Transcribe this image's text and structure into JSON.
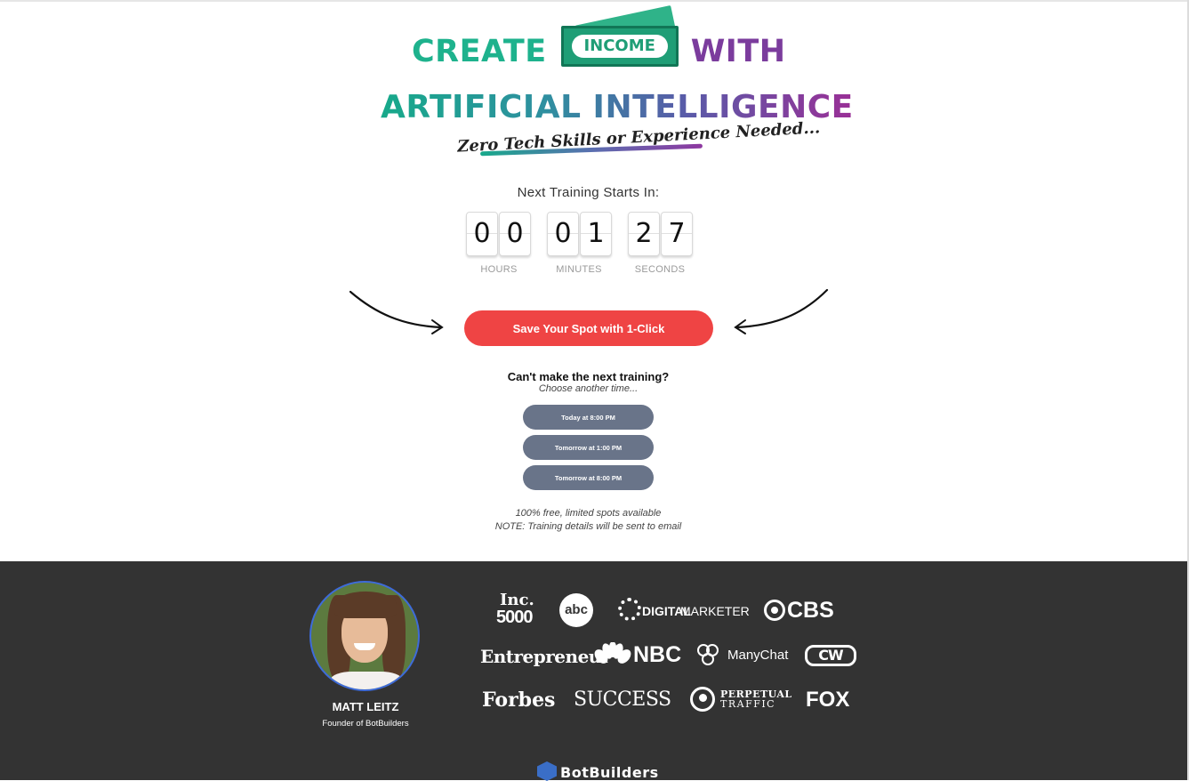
{
  "hero": {
    "word_create": "CREATE",
    "word_income": "INCOME",
    "word_with": "WITH",
    "line2": "ARTIFICIAL INTELLIGENCE",
    "tagline": "Zero Tech Skills or Experience Needed..."
  },
  "countdown": {
    "title": "Next Training Starts In:",
    "digits": {
      "h1": "0",
      "h2": "0",
      "m1": "0",
      "m2": "1",
      "s1": "2",
      "s2": "7"
    },
    "labels": {
      "hours": "HOURS",
      "minutes": "MINUTES",
      "seconds": "SECONDS"
    }
  },
  "cta": {
    "label": "Save Your Spot with 1-Click"
  },
  "alternate": {
    "heading": "Can't make the next training?",
    "subheading": "Choose another time...",
    "slots": [
      {
        "label": "Today at 8:00 PM"
      },
      {
        "label": "Tomorrow at 1:00 PM"
      },
      {
        "label": "Tomorrow at 8:00 PM"
      }
    ]
  },
  "notes": {
    "free": "100% free, limited spots available",
    "email": "NOTE: Training details will be sent to email"
  },
  "presenter": {
    "name": "MATT LEITZ",
    "role": "Founder of BotBuilders"
  },
  "press_logos": {
    "inc_top": "Inc.",
    "inc_bottom": "5000",
    "abc": "abc",
    "digital_marketer_a": "DIGITAL",
    "digital_marketer_b": "MARKETER",
    "cbs": "CBS",
    "entrepreneur": "Entrepreneur",
    "nbc": "NBC",
    "manychat": "ManyChat",
    "cw": "CW",
    "forbes": "Forbes",
    "success": "SUCCESS",
    "perpetual_a": "PERPETUAL",
    "perpetual_b": "TRAFFIC",
    "fox": "FOX"
  },
  "brand": {
    "footer_logo": "BotBuilders"
  },
  "colors": {
    "cta": "#ef4444",
    "slot_button": "#697489",
    "footer_bg": "#333333",
    "teal": "#1eb28d",
    "purple": "#7b3c9d"
  }
}
